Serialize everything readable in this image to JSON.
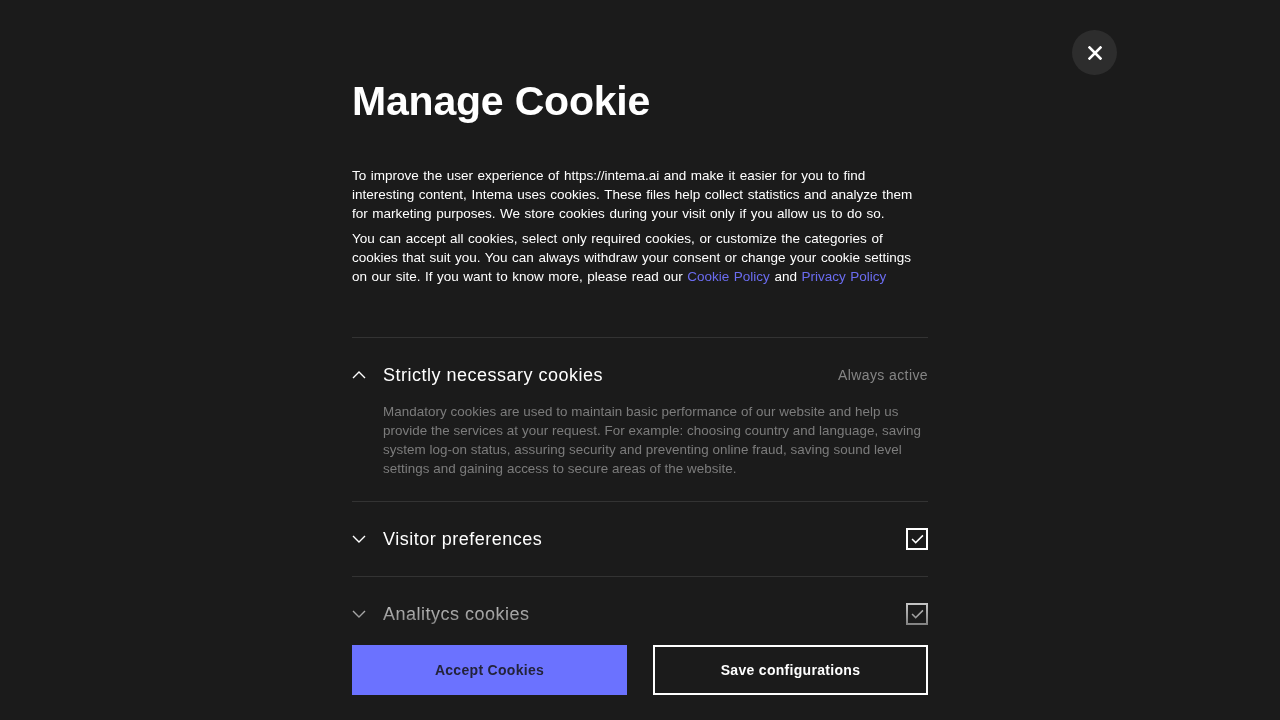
{
  "title": "Manage Cookie",
  "paragraphs": [
    {
      "parts": [
        {
          "kind": "text",
          "text": "To improve the user experience of https://intema.ai and make it easier for you to find interesting content, Intema uses cookies. These files help collect statistics and analyze them for marketing purposes. We store cookies during your visit only if you allow us to do so."
        }
      ]
    },
    {
      "parts": [
        {
          "kind": "text",
          "text": "You can accept all cookies, select only required cookies, or customize the categories of cookies that suit you. You can always withdraw your consent or change your cookie settings on our site. If you want to know more, please read our "
        },
        {
          "kind": "link",
          "text": "Cookie Policy"
        },
        {
          "kind": "text",
          "text": " and "
        },
        {
          "kind": "link",
          "text": "Privacy Policy"
        }
      ]
    }
  ],
  "categories": [
    {
      "kind": "always",
      "name": "Strictly necessary cookies",
      "expanded": true,
      "status": "Always active",
      "description": "Mandatory cookies are used to maintain basic performance of our website and help us provide the services at your request. For example: choosing country and language, saving system log-on status, assuring security and preventing online fraud, saving sound level settings and gaining access to secure areas of the website."
    },
    {
      "kind": "toggle",
      "name": "Visitor preferences",
      "expanded": false,
      "checked": true
    },
    {
      "kind": "toggle",
      "name": "Analitycs cookies",
      "expanded": false,
      "checked": true
    }
  ],
  "buttons": [
    {
      "kind": "primary",
      "label": "Accept Cookies"
    },
    {
      "kind": "secondary",
      "label": "Save configurations"
    }
  ]
}
